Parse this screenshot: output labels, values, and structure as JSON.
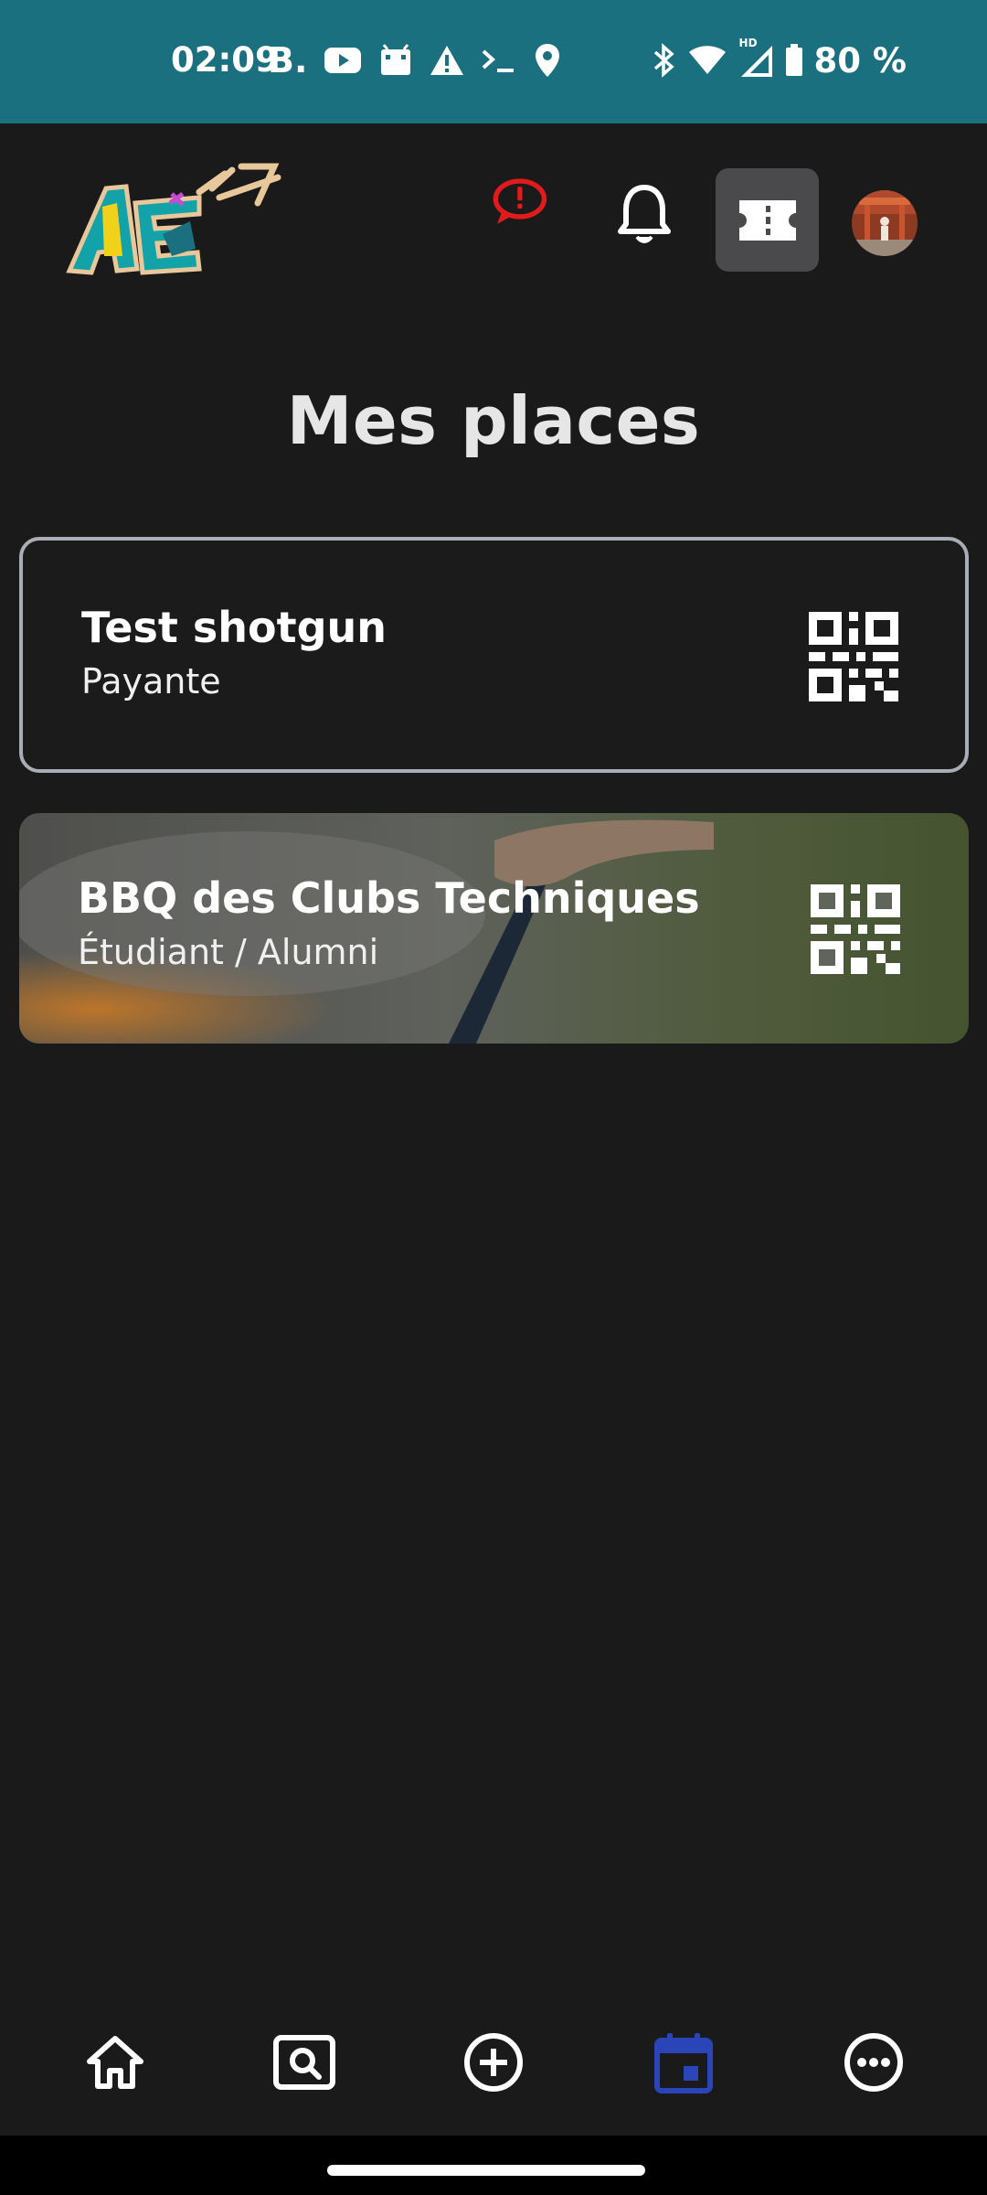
{
  "status_bar": {
    "time": "02:09",
    "battery": "80 %",
    "background_color": "#1b707f",
    "left_icons": [
      "booking-icon",
      "youtube-icon",
      "android-icon",
      "warning-icon",
      "terminal-icon",
      "location-icon"
    ],
    "right_icons": [
      "bluetooth-icon",
      "wifi-icon",
      "signal-icon",
      "battery-icon"
    ],
    "hd_label": "HD",
    "booking_glyph": "B."
  },
  "header": {
    "alert_color": "#e11b1b",
    "icons": [
      "alert-chat-icon",
      "bell-icon",
      "ticket-icon",
      "avatar"
    ]
  },
  "page": {
    "title": "Mes places"
  },
  "tickets": [
    {
      "title": "Test shotgun",
      "subtitle": "Payante",
      "icon": "qr-code-icon"
    },
    {
      "title": "BBQ des Clubs Techniques",
      "subtitle": "Étudiant / Alumni",
      "icon": "qr-code-icon"
    }
  ],
  "bottom_nav": {
    "items": [
      "home-icon",
      "search-icon",
      "add-icon",
      "calendar-icon",
      "more-icon"
    ],
    "active": "calendar-icon",
    "active_color": "#2a45b8"
  }
}
